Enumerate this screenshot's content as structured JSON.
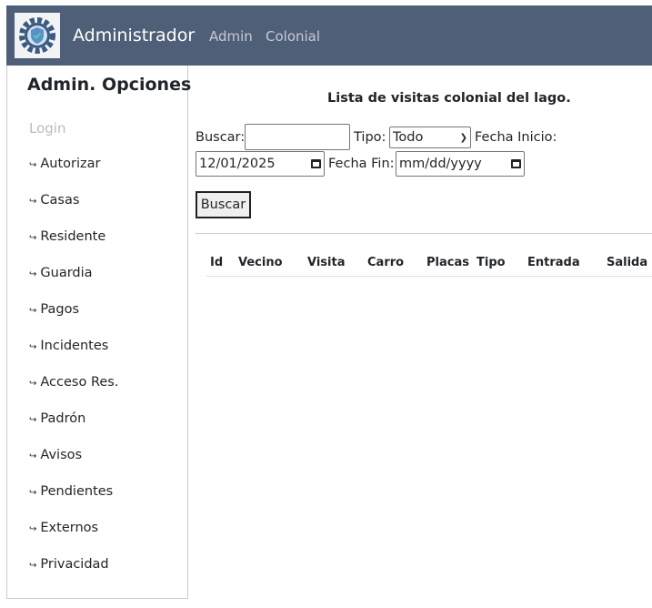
{
  "navbar": {
    "brand": "Administrador",
    "links": [
      "Admin",
      "Colonial"
    ]
  },
  "sidebar": {
    "title": "Admin. Opciones",
    "login": "Login",
    "items": [
      "Autorizar",
      "Casas",
      "Residente",
      "Guardia",
      "Pagos",
      "Incidentes",
      "Acceso Res.",
      "Padrón",
      "Avisos",
      "Pendientes",
      "Externos",
      "Privacidad"
    ]
  },
  "main": {
    "title": "Lista de visitas colonial del lago.",
    "buscar_label": "Buscar:",
    "buscar_value": "",
    "tipo_label": "Tipo:",
    "tipo_value": "Todo",
    "fecha_inicio_label": "Fecha Inicio:",
    "fecha_inicio_value": "12/01/2025",
    "fecha_fin_label": "Fecha Fin:",
    "fecha_fin_placeholder": "mm/dd/yyyy",
    "button": "Buscar",
    "columns": [
      "Id",
      "Vecino",
      "Visita",
      "Carro",
      "Placas",
      "Tipo",
      "Entrada",
      "Salida"
    ]
  },
  "colors": {
    "navbar": "#505f78"
  }
}
